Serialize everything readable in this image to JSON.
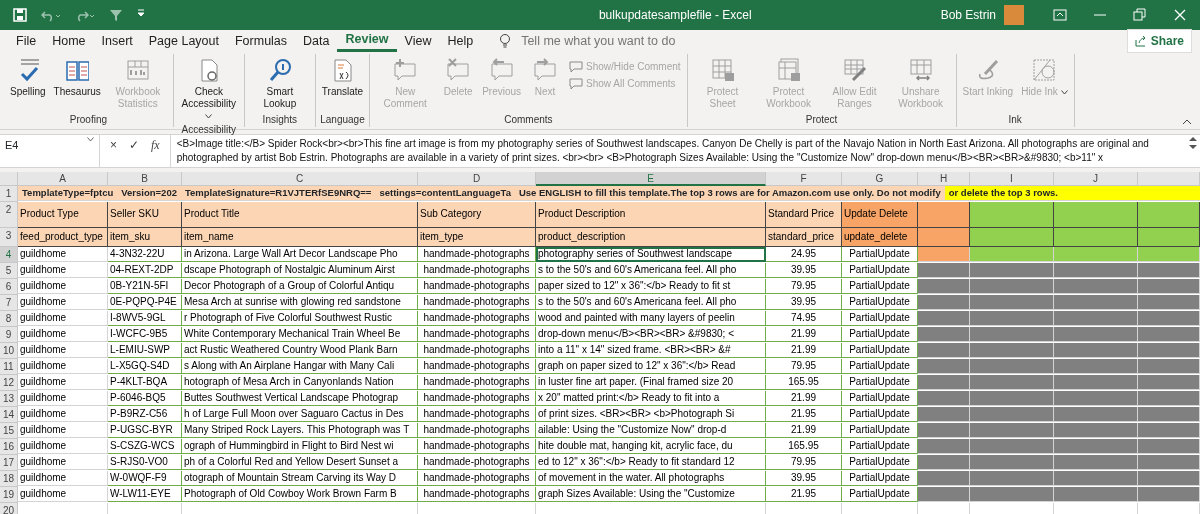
{
  "window": {
    "title": "bulkupdatesamplefile  -  Excel",
    "user": "Bob Estrin"
  },
  "menu_tabs": [
    {
      "label": "File",
      "selected": false
    },
    {
      "label": "Home",
      "selected": false
    },
    {
      "label": "Insert",
      "selected": false
    },
    {
      "label": "Page Layout",
      "selected": false
    },
    {
      "label": "Formulas",
      "selected": false
    },
    {
      "label": "Data",
      "selected": false
    },
    {
      "label": "Review",
      "selected": true
    },
    {
      "label": "View",
      "selected": false
    },
    {
      "label": "Help",
      "selected": false
    }
  ],
  "tell_me": {
    "placeholder": "Tell me what you want to do"
  },
  "share": {
    "label": "Share"
  },
  "ribbon_groups": [
    {
      "label": "Proofing",
      "buttons": [
        {
          "label": "Spelling",
          "kind": "large",
          "disabled": false,
          "menu": false
        },
        {
          "label": "Thesaurus",
          "kind": "large",
          "disabled": false,
          "menu": false
        },
        {
          "label": "Workbook Statistics",
          "kind": "large",
          "disabled": true,
          "menu": false
        }
      ]
    },
    {
      "label": "Accessibility",
      "buttons": [
        {
          "label": "Check Accessibility",
          "kind": "large",
          "disabled": false,
          "menu": true
        }
      ]
    },
    {
      "label": "Insights",
      "buttons": [
        {
          "label": "Smart Lookup",
          "kind": "large",
          "disabled": false,
          "menu": false
        }
      ]
    },
    {
      "label": "Language",
      "buttons": [
        {
          "label": "Translate",
          "kind": "large",
          "disabled": false,
          "menu": false
        }
      ]
    },
    {
      "label": "Comments",
      "buttons": [
        {
          "label": "New Comment",
          "kind": "large",
          "disabled": true,
          "menu": false
        },
        {
          "label": "Delete",
          "kind": "large",
          "disabled": true,
          "menu": false
        },
        {
          "label": "Previous",
          "kind": "large",
          "disabled": true,
          "menu": false
        },
        {
          "label": "Next",
          "kind": "large",
          "disabled": true,
          "menu": false
        },
        {
          "label": "Show/Hide Comment",
          "kind": "small",
          "disabled": true
        },
        {
          "label": "Show All Comments",
          "kind": "small",
          "disabled": true
        }
      ]
    },
    {
      "label": "Protect",
      "buttons": [
        {
          "label": "Protect Sheet",
          "kind": "large",
          "disabled": true,
          "menu": false
        },
        {
          "label": "Protect Workbook",
          "kind": "large",
          "disabled": true,
          "menu": false
        },
        {
          "label": "Allow Edit Ranges",
          "kind": "large",
          "disabled": true,
          "menu": false
        },
        {
          "label": "Unshare Workbook",
          "kind": "large",
          "disabled": true,
          "menu": false
        }
      ]
    },
    {
      "label": "Ink",
      "buttons": [
        {
          "label": "Start Inking",
          "kind": "large",
          "disabled": true,
          "menu": false
        },
        {
          "label": "Hide Ink",
          "kind": "large",
          "disabled": true,
          "menu": true
        }
      ]
    }
  ],
  "formula_bar": {
    "name_box": "E4",
    "cancel": "×",
    "enter": "✓",
    "function": "fx",
    "value": "<B>Image title:</B> Spider Rock<br><br>This fine art image is from my photography series of Southwest landscapes. Canyon De Chelly is part of the Navajo Nation in North East Arizona. All photographs are original and photographed by artist Bob Estrin. Photographs are available in a variety of print sizes. <br><br> <B>Photograph Sizes Available: Using the \"Customize Now\" drop-down menu</B><BR><BR>&#9830; <b>11\" x"
  },
  "columns": [
    {
      "letter": "A",
      "selected": false
    },
    {
      "letter": "B",
      "selected": false
    },
    {
      "letter": "C",
      "selected": false
    },
    {
      "letter": "D",
      "selected": false
    },
    {
      "letter": "E",
      "selected": true
    },
    {
      "letter": "F",
      "selected": false
    },
    {
      "letter": "G",
      "selected": false
    },
    {
      "letter": "H",
      "selected": false
    },
    {
      "letter": "I",
      "selected": false
    },
    {
      "letter": "J",
      "selected": false
    },
    {
      "selected": false
    }
  ],
  "banner_row": {
    "number": "1",
    "selected": false,
    "segments": [
      {
        "text": "TemplateType=fptcu",
        "color": "#fcd5b4"
      },
      {
        "text": "Version=202",
        "color": "#fcd5b4"
      },
      {
        "text": "TemplateSignature=R1VJTERfSE9NRQ==",
        "color": "#fcd5b4"
      },
      {
        "text": "settings=contentLanguageTa",
        "color": "#fcd5b4"
      },
      {
        "text": "Use ENGLISH to fill this template.The top 3 rows are for Amazon.com use only. Do not modify",
        "color": "#fcd5b4"
      },
      {
        "text": "or delete the top 3 rows.",
        "color": "#ffff00"
      }
    ]
  },
  "rows": [
    {
      "number": "2",
      "selected": false,
      "cells": [
        {
          "text": "Product Type",
          "color": "#fcd5b4"
        },
        {
          "text": "Seller SKU",
          "color": "#fcd5b4"
        },
        {
          "text": "Product Title",
          "color": "#fcd5b4"
        },
        {
          "text": "Sub Category",
          "color": "#fcd5b4"
        },
        {
          "text": "Product Description",
          "color": "#fcd5b4"
        },
        {
          "text": "Standard Price",
          "color": "#fcd5b4"
        },
        {
          "text": "Update Delete",
          "color": "#f8a466"
        },
        {
          "color": "#f8a466"
        },
        {
          "color": "#92d050"
        },
        {
          "color": "#92d050"
        },
        {
          "color": "#92d050"
        }
      ]
    },
    {
      "number": "3",
      "selected": false,
      "cells": [
        {
          "text": "feed_product_type",
          "color": "#fcd5b4"
        },
        {
          "text": "item_sku",
          "color": "#fcd5b4"
        },
        {
          "text": "item_name",
          "color": "#fcd5b4"
        },
        {
          "text": "item_type",
          "color": "#fcd5b4"
        },
        {
          "text": "product_description",
          "color": "#fcd5b4"
        },
        {
          "text": "standard_price",
          "color": "#fcd5b4"
        },
        {
          "text": "update_delete",
          "color": "#f8a466"
        },
        {
          "color": "#f8a466"
        },
        {
          "color": "#92d050"
        },
        {
          "color": "#92d050"
        },
        {
          "color": "#92d050"
        }
      ]
    },
    {
      "number": "4",
      "selected": true,
      "cells": [
        {
          "text": "guildhome"
        },
        {
          "text": "4-3N32-22U"
        },
        {
          "text": "in Arizona. Large Wall Art Decor Landscape Pho"
        },
        {
          "text": "handmade-photographs"
        },
        {
          "text": " photography series of Southwest landscape"
        },
        {
          "text": "24.95"
        },
        {
          "text": "PartialUpdate"
        },
        {
          "color": "#f8a466"
        },
        {
          "color": "#92d050"
        },
        {
          "color": "#92d050"
        },
        {
          "color": "#92d050"
        }
      ]
    },
    {
      "number": "5",
      "selected": false,
      "cells": [
        {
          "text": "guildhome"
        },
        {
          "text": "04-REXT-2DP"
        },
        {
          "text": "dscape Photograph of Nostalgic Aluminum Airst"
        },
        {
          "text": "handmade-photographs"
        },
        {
          "text": "s to the 50's and 60's Americana feel. All pho"
        },
        {
          "text": "39.95"
        },
        {
          "text": "PartialUpdate"
        },
        {
          "color": "#808080"
        },
        {
          "color": "#808080"
        },
        {
          "color": "#808080"
        },
        {
          "color": "#808080"
        }
      ]
    },
    {
      "number": "6",
      "selected": false,
      "cells": [
        {
          "text": "guildhome"
        },
        {
          "text": "0B-Y21N-5FI"
        },
        {
          "text": "Decor Photograph of a Group of Colorful Antiqu"
        },
        {
          "text": "handmade-photographs"
        },
        {
          "text": " paper sized to 12\" x 36\":</b> Ready to fit st"
        },
        {
          "text": "79.95"
        },
        {
          "text": "PartialUpdate"
        },
        {
          "color": "#808080"
        },
        {
          "color": "#808080"
        },
        {
          "color": "#808080"
        },
        {
          "color": "#808080"
        }
      ]
    },
    {
      "number": "7",
      "selected": false,
      "cells": [
        {
          "text": "guildhome"
        },
        {
          "text": "0E-PQPQ-P4E"
        },
        {
          "text": "Mesa Arch at sunrise with glowing red sandstone"
        },
        {
          "text": "handmade-photographs"
        },
        {
          "text": "s to the 50's and 60's Americana feel. All pho"
        },
        {
          "text": "39.95"
        },
        {
          "text": "PartialUpdate"
        },
        {
          "color": "#808080"
        },
        {
          "color": "#808080"
        },
        {
          "color": "#808080"
        },
        {
          "color": "#808080"
        }
      ]
    },
    {
      "number": "8",
      "selected": false,
      "cells": [
        {
          "text": "guildhome"
        },
        {
          "text": "I-8WV5-9GL"
        },
        {
          "text": "r Photograph of Five Colorful Southwest Rustic"
        },
        {
          "text": "handmade-photographs"
        },
        {
          "text": "wood and painted with many layers of peelin"
        },
        {
          "text": "74.95"
        },
        {
          "text": "PartialUpdate"
        },
        {
          "color": "#808080"
        },
        {
          "color": "#808080"
        },
        {
          "color": "#808080"
        },
        {
          "color": "#808080"
        }
      ]
    },
    {
      "number": "9",
      "selected": false,
      "cells": [
        {
          "text": "guildhome"
        },
        {
          "text": "I-WCFC-9B5"
        },
        {
          "text": "White Contemporary Mechanical Train Wheel Be"
        },
        {
          "text": "handmade-photographs"
        },
        {
          "text": "drop-down menu</B><BR><BR> &#9830; <"
        },
        {
          "text": "21.99"
        },
        {
          "text": "PartialUpdate"
        },
        {
          "color": "#808080"
        },
        {
          "color": "#808080"
        },
        {
          "color": "#808080"
        },
        {
          "color": "#808080"
        }
      ]
    },
    {
      "number": "10",
      "selected": false,
      "cells": [
        {
          "text": "guildhome"
        },
        {
          "text": "L-EMIU-SWP"
        },
        {
          "text": "act Rustic Weathered Country Wood Plank Barn"
        },
        {
          "text": "handmade-photographs"
        },
        {
          "text": " into a 11\" x 14\" sized frame. <BR><BR> &#"
        },
        {
          "text": "21.99"
        },
        {
          "text": "PartialUpdate"
        },
        {
          "color": "#808080"
        },
        {
          "color": "#808080"
        },
        {
          "color": "#808080"
        },
        {
          "color": "#808080"
        }
      ]
    },
    {
      "number": "11",
      "selected": false,
      "cells": [
        {
          "text": "guildhome"
        },
        {
          "text": "L-X5GQ-S4D"
        },
        {
          "text": "s Along with An Airplane Hangar with Many Cali"
        },
        {
          "text": "handmade-photographs"
        },
        {
          "text": "graph on paper sized to 12\" x 36\":</b> Read"
        },
        {
          "text": "79.95"
        },
        {
          "text": "PartialUpdate"
        },
        {
          "color": "#808080"
        },
        {
          "color": "#808080"
        },
        {
          "color": "#808080"
        },
        {
          "color": "#808080"
        }
      ]
    },
    {
      "number": "12",
      "selected": false,
      "cells": [
        {
          "text": "guildhome"
        },
        {
          "text": "P-4KLT-BQA"
        },
        {
          "text": "hotograph of Mesa Arch in Canyonlands Nation"
        },
        {
          "text": "handmade-photographs"
        },
        {
          "text": "in luster fine art paper. (Final framed size 20"
        },
        {
          "text": "165.95"
        },
        {
          "text": "PartialUpdate"
        },
        {
          "color": "#808080"
        },
        {
          "color": "#808080"
        },
        {
          "color": "#808080"
        },
        {
          "color": "#808080"
        }
      ]
    },
    {
      "number": "13",
      "selected": false,
      "cells": [
        {
          "text": "guildhome"
        },
        {
          "text": "P-6046-BQ5"
        },
        {
          "text": "Buttes Southwest Vertical Landscape Photograp"
        },
        {
          "text": "handmade-photographs"
        },
        {
          "text": " x 20\" matted print:</b> Ready to fit into a"
        },
        {
          "text": "21.99"
        },
        {
          "text": "PartialUpdate"
        },
        {
          "color": "#808080"
        },
        {
          "color": "#808080"
        },
        {
          "color": "#808080"
        },
        {
          "color": "#808080"
        }
      ]
    },
    {
      "number": "14",
      "selected": false,
      "cells": [
        {
          "text": "guildhome"
        },
        {
          "text": "P-B9RZ-C56"
        },
        {
          "text": "h of Large Full Moon over Saguaro Cactus in Des"
        },
        {
          "text": "handmade-photographs"
        },
        {
          "text": "of print sizes. <BR><BR> <b>Photograph Si"
        },
        {
          "text": "21.95"
        },
        {
          "text": "PartialUpdate"
        },
        {
          "color": "#808080"
        },
        {
          "color": "#808080"
        },
        {
          "color": "#808080"
        },
        {
          "color": "#808080"
        }
      ]
    },
    {
      "number": "15",
      "selected": false,
      "cells": [
        {
          "text": "guildhome"
        },
        {
          "text": "P-UGSC-BYR"
        },
        {
          "text": "Many Striped Rock Layers. This Photograph was T"
        },
        {
          "text": "handmade-photographs"
        },
        {
          "text": "ailable: Using the \"Customize Now\" drop-d"
        },
        {
          "text": "21.99"
        },
        {
          "text": "PartialUpdate"
        },
        {
          "color": "#808080"
        },
        {
          "color": "#808080"
        },
        {
          "color": "#808080"
        },
        {
          "color": "#808080"
        }
      ]
    },
    {
      "number": "16",
      "selected": false,
      "cells": [
        {
          "text": "guildhome"
        },
        {
          "text": "S-CSZG-WCS"
        },
        {
          "text": "ograph of Hummingbird in Flight to Bird Nest wi"
        },
        {
          "text": "handmade-photographs"
        },
        {
          "text": "hite double mat, hanging kit, acrylic face, du"
        },
        {
          "text": "165.95"
        },
        {
          "text": "PartialUpdate"
        },
        {
          "color": "#808080"
        },
        {
          "color": "#808080"
        },
        {
          "color": "#808080"
        },
        {
          "color": "#808080"
        }
      ]
    },
    {
      "number": "17",
      "selected": false,
      "cells": [
        {
          "text": "guildhome"
        },
        {
          "text": "S-RJS0-VO0"
        },
        {
          "text": "ph of a Colorful Red and Yellow Desert Sunset a"
        },
        {
          "text": "handmade-photographs"
        },
        {
          "text": "ed to 12\" x 36\":</b> Ready to fit standard 12"
        },
        {
          "text": "79.95"
        },
        {
          "text": "PartialUpdate"
        },
        {
          "color": "#808080"
        },
        {
          "color": "#808080"
        },
        {
          "color": "#808080"
        },
        {
          "color": "#808080"
        }
      ]
    },
    {
      "number": "18",
      "selected": false,
      "cells": [
        {
          "text": "guildhome"
        },
        {
          "text": "W-0WQF-F9"
        },
        {
          "text": "otograph of Mountain Stream Carving its Way D"
        },
        {
          "text": "handmade-photographs"
        },
        {
          "text": "of movement in the water. All photographs"
        },
        {
          "text": "39.95"
        },
        {
          "text": "PartialUpdate"
        },
        {
          "color": "#808080"
        },
        {
          "color": "#808080"
        },
        {
          "color": "#808080"
        },
        {
          "color": "#808080"
        }
      ]
    },
    {
      "number": "19",
      "selected": false,
      "cells": [
        {
          "text": "guildhome"
        },
        {
          "text": "W-LW11-EYE"
        },
        {
          "text": "Photograph of Old Cowboy Work Brown Farm B"
        },
        {
          "text": "handmade-photographs"
        },
        {
          "text": "graph Sizes Available: Using the \"Customize"
        },
        {
          "text": "21.95"
        },
        {
          "text": "PartialUpdate"
        },
        {
          "color": "#808080"
        },
        {
          "color": "#808080"
        },
        {
          "color": "#808080"
        },
        {
          "color": "#808080"
        }
      ]
    },
    {
      "number": "20",
      "selected": false
    }
  ]
}
